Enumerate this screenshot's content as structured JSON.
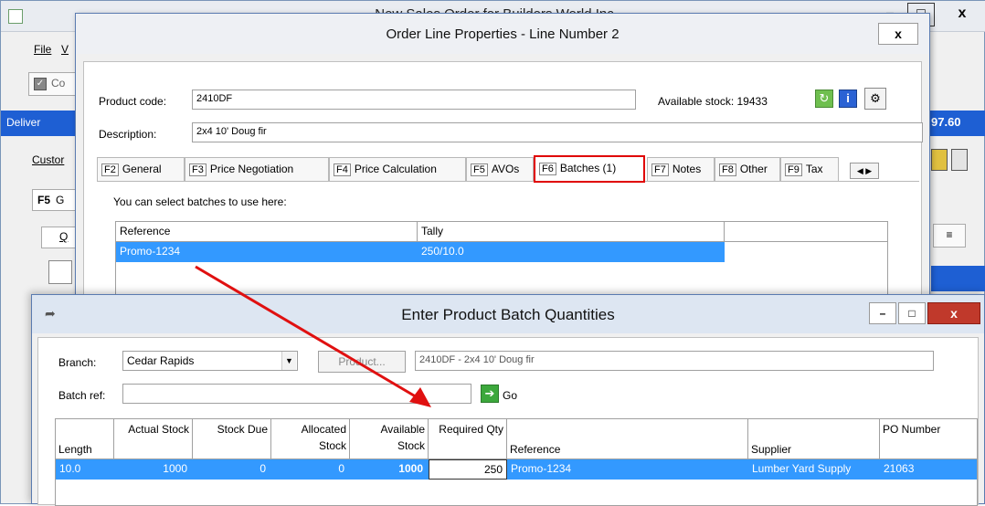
{
  "background_window": {
    "title": "New Sales Order for Builders World Inc",
    "controls": {
      "minimize": "–",
      "maximize": "□",
      "close": "x"
    },
    "menu": {
      "file": "File",
      "view": "V"
    },
    "toolbar_label": "Co",
    "deliver_label": "Deliver",
    "total_fragment": "97.60",
    "customer_label": "Custor",
    "f5_tab": {
      "key": "F5",
      "label": "G"
    },
    "q_button": "Q"
  },
  "order_line_dialog": {
    "title": "Order Line Properties - Line Number 2",
    "close": "x",
    "product_code_label": "Product code:",
    "product_code_value": "2410DF",
    "available_stock_label": "Available stock:",
    "available_stock_value": "19433",
    "description_label": "Description:",
    "description_value": "2x4 10' Doug fir",
    "tabs": [
      {
        "key": "F2",
        "label": "General"
      },
      {
        "key": "F3",
        "label": "Price Negotiation"
      },
      {
        "key": "F4",
        "label": "Price Calculation"
      },
      {
        "key": "F5",
        "label": "AVOs"
      },
      {
        "key": "F6",
        "label": "Batches (1)",
        "active": true
      },
      {
        "key": "F7",
        "label": "Notes"
      },
      {
        "key": "F8",
        "label": "Other"
      },
      {
        "key": "F9",
        "label": "Tax"
      }
    ],
    "select_hint": "You can select batches to use here:",
    "batch_grid": {
      "columns": [
        "Reference",
        "Tally",
        ""
      ],
      "rows": [
        {
          "reference": "Promo-1234",
          "tally": "250/10.0"
        }
      ]
    }
  },
  "batch_qty_dialog": {
    "title": "Enter Product Batch Quantities",
    "controls": {
      "minimize": "–",
      "maximize": "□",
      "close": "x"
    },
    "branch_label": "Branch:",
    "branch_value": "Cedar Rapids",
    "product_button": "Product...",
    "product_value": "2410DF - 2x4 10' Doug fir",
    "batch_ref_label": "Batch ref:",
    "batch_ref_value": "",
    "go_label": "Go",
    "grid": {
      "columns": [
        {
          "id": "length",
          "label": "Length"
        },
        {
          "id": "actual_stock",
          "label": "Actual Stock"
        },
        {
          "id": "stock_due",
          "label": "Stock Due"
        },
        {
          "id": "allocated_stock",
          "label": "Allocated Stock"
        },
        {
          "id": "available_stock",
          "label": "Available Stock"
        },
        {
          "id": "required_qty",
          "label": "Required Qty"
        },
        {
          "id": "reference",
          "label": "Reference"
        },
        {
          "id": "supplier",
          "label": "Supplier"
        },
        {
          "id": "po_number",
          "label": "PO Number"
        }
      ],
      "rows": [
        {
          "length": "10.0",
          "actual_stock": "1000",
          "stock_due": "0",
          "allocated_stock": "0",
          "available_stock": "1000",
          "required_qty": "250",
          "reference": "Promo-1234",
          "supplier": "Lumber Yard Supply",
          "po_number": "21063"
        }
      ]
    }
  },
  "colors": {
    "selection_blue": "#3399ff",
    "highlight_red": "#e00000",
    "title_blue_bar": "#1e5fd3"
  }
}
